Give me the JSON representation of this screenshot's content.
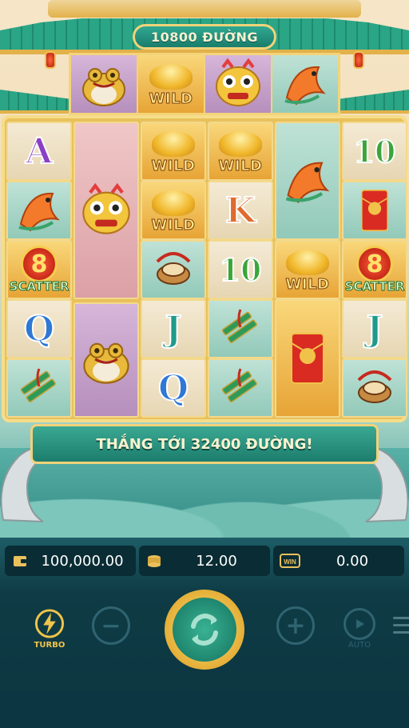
{
  "header": {
    "ways_text": "10800 ĐƯỜNG"
  },
  "top_reel": [
    {
      "symbol": "golden-toad"
    },
    {
      "symbol": "wild",
      "label": "WILD"
    },
    {
      "symbol": "lion-dance-head"
    },
    {
      "symbol": "koi-fish"
    }
  ],
  "grid": {
    "col1": [
      {
        "symbol": "letter-a",
        "label": "A",
        "color": "#8a3fc4",
        "bg": "cream"
      },
      {
        "symbol": "koi-fish",
        "bg": "teal"
      },
      {
        "symbol": "scatter",
        "label": "SCATTER",
        "number": "8",
        "bg": "gold"
      },
      {
        "symbol": "letter-q",
        "label": "Q",
        "color": "#2e78d6",
        "bg": "cream"
      },
      {
        "symbol": "firecrackers",
        "bg": "teal"
      }
    ],
    "col2": [
      {
        "symbol": "lion-dance-head",
        "bg": "pink",
        "tall": true
      },
      {
        "symbol": "golden-toad",
        "bg": "mauve",
        "tall": true
      }
    ],
    "col3": [
      {
        "symbol": "wild",
        "label": "WILD",
        "bg": "gold"
      },
      {
        "symbol": "wild",
        "label": "WILD",
        "bg": "gold"
      },
      {
        "symbol": "drum",
        "bg": "teal"
      },
      {
        "symbol": "letter-j",
        "label": "J",
        "color": "#1f9a8a",
        "bg": "cream"
      },
      {
        "symbol": "letter-q",
        "label": "Q",
        "color": "#2e78d6",
        "bg": "cream"
      }
    ],
    "col4": [
      {
        "symbol": "wild",
        "label": "WILD",
        "bg": "gold"
      },
      {
        "symbol": "letter-k",
        "label": "K",
        "color": "#e06a2c",
        "bg": "cream"
      },
      {
        "symbol": "ten",
        "label": "10",
        "color": "#3aa63a",
        "bg": "cream"
      },
      {
        "symbol": "firecrackers",
        "bg": "teal"
      },
      {
        "symbol": "firecrackers",
        "bg": "teal"
      }
    ],
    "col5": [
      {
        "symbol": "koi-fish",
        "bg": "teal",
        "tall": true
      },
      {
        "symbol": "wild",
        "label": "WILD",
        "bg": "gold"
      },
      {
        "symbol": "red-envelope",
        "bg": "gold",
        "tall": true
      }
    ],
    "col6": [
      {
        "symbol": "ten",
        "label": "10",
        "color": "#3aa63a",
        "bg": "cream"
      },
      {
        "symbol": "red-envelope",
        "bg": "teal"
      },
      {
        "symbol": "scatter",
        "label": "SCATTER",
        "number": "8",
        "bg": "gold"
      },
      {
        "symbol": "letter-j",
        "label": "J",
        "color": "#1f9a8a",
        "bg": "cream"
      },
      {
        "symbol": "drum",
        "bg": "teal"
      }
    ]
  },
  "win_message": "THẮNG TỚI 32400 ĐƯỜNG!",
  "stats": {
    "balance": "100,000.00",
    "bet": "12.00",
    "win": "0.00",
    "win_badge": "WIN"
  },
  "controls": {
    "turbo_label": "TURBO",
    "minus_label": "−",
    "plus_label": "+",
    "auto_label": "AUTO"
  },
  "colors": {
    "gold": "#e9c15c",
    "teal": "#1d7d6d",
    "panel": "#0c3641"
  }
}
